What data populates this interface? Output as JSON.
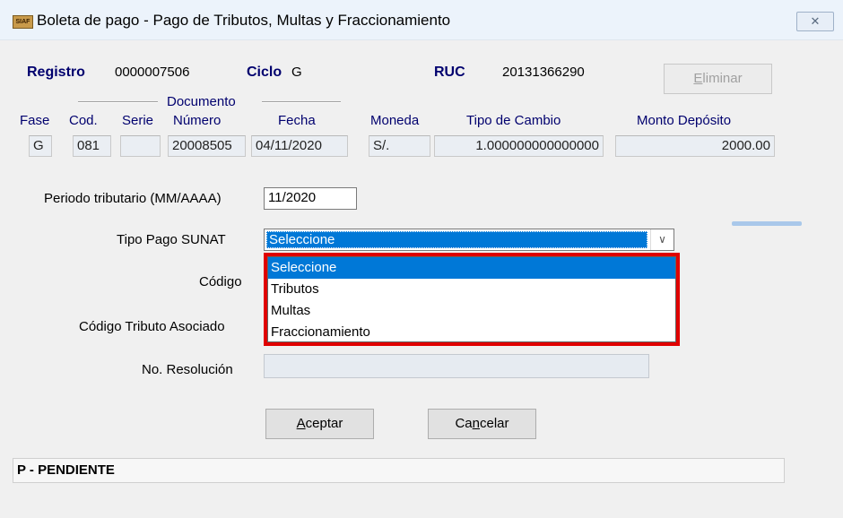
{
  "window": {
    "title": "Boleta de pago - Pago de Tributos, Multas y Fraccionamiento",
    "app_icon_text": "SIAF",
    "close_glyph": "✕"
  },
  "header": {
    "registro_label": "Registro",
    "registro_value": "0000007506",
    "ciclo_label": "Ciclo",
    "ciclo_value": "G",
    "ruc_label": "RUC",
    "ruc_value": "20131366290",
    "eliminar_label": "Eliminar",
    "eliminar_accel": "E",
    "eliminar_rest": "liminar"
  },
  "grid": {
    "documento_header": "Documento",
    "columns": {
      "fase": "Fase",
      "cod": "Cod.",
      "serie": "Serie",
      "numero": "Número",
      "fecha": "Fecha",
      "moneda": "Moneda",
      "tipo_cambio": "Tipo de Cambio",
      "monto": "Monto Depósito"
    },
    "values": {
      "fase": "G",
      "cod": "081",
      "serie": "",
      "numero": "20008505",
      "fecha": "04/11/2020",
      "moneda": "S/.",
      "tipo_cambio": "1.000000000000000",
      "monto": "2000.00"
    }
  },
  "form": {
    "periodo_label": "Periodo tributario (MM/AAAA)",
    "periodo_value": "11/2020",
    "tipo_pago_label": "Tipo Pago SUNAT",
    "tipo_pago_selected": "Seleccione",
    "codigo_label": "Código",
    "codigo_tributo_label": "Código Tributo Asociado",
    "resolucion_label": "No. Resolución",
    "dropdown_options": [
      "Seleccione",
      "Tributos",
      "Multas",
      "Fraccionamiento"
    ],
    "dropdown_highlighted": 0
  },
  "buttons": {
    "aceptar_accel": "A",
    "aceptar_rest": "ceptar",
    "cancelar_pre": "Ca",
    "cancelar_accel": "n",
    "cancelar_rest": "celar"
  },
  "status": {
    "text": "P - PENDIENTE"
  },
  "colors": {
    "selection": "#0078d7",
    "highlight_border": "#e00000",
    "label_blue": "#00006e"
  }
}
